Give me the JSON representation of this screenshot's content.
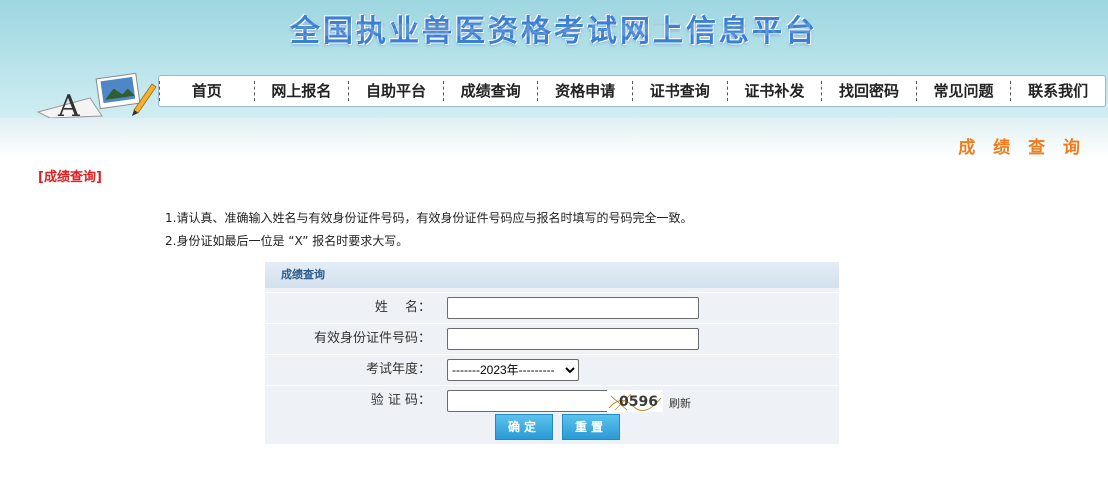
{
  "site": {
    "title": "全国执业兽医资格考试网上信息平台"
  },
  "nav": {
    "items": [
      "首页",
      "网上报名",
      "自助平台",
      "成绩查询",
      "资格申请",
      "证书查询",
      "证书补发",
      "找回密码",
      "常见问题",
      "联系我们"
    ]
  },
  "page": {
    "heading": "成 绩 查 询",
    "breadcrumb": "[成绩查询]",
    "notes": [
      "1.请认真、准确输入姓名与有效身份证件号码，有效身份证件号码应与报名时填写的号码完全一致。",
      "2.身份证如最后一位是 “X” 报名时要求大写。"
    ]
  },
  "form": {
    "title": "成绩查询",
    "name_label": "姓　 名：",
    "id_label": "有效身份证件号码：",
    "year_label": "考试年度：",
    "captcha_label": "验 证 码：",
    "year_selected": "-------2023年---------",
    "captcha_text": "0596",
    "refresh_label": "刷新",
    "confirm_label": "确定",
    "reset_label": "重置"
  },
  "colors": {
    "accent_orange": "#f07d1a",
    "breadcrumb_red": "#e11d1d",
    "button_blue": "#2a9ad6",
    "title_blue": "#3a7fd3"
  }
}
